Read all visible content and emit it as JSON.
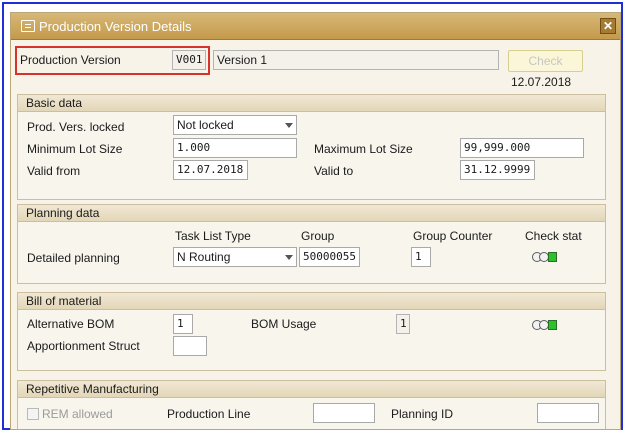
{
  "window": {
    "title": "Production Version Details",
    "close_glyph": "✕"
  },
  "header": {
    "production_version_label": "Production Version",
    "production_version_value": "V001",
    "description_value": "Version 1",
    "check_label": "Check",
    "date": "12.07.2018"
  },
  "basic_data": {
    "title": "Basic data",
    "locked_label": "Prod. Vers. locked",
    "locked_value": "Not locked",
    "min_lot_label": "Minimum Lot Size",
    "min_lot_value": "1.000",
    "max_lot_label": "Maximum Lot Size",
    "max_lot_value": "99,999.000",
    "valid_from_label": "Valid from",
    "valid_from_value": "12.07.2018",
    "valid_to_label": "Valid to",
    "valid_to_value": "31.12.9999"
  },
  "planning_data": {
    "title": "Planning data",
    "col_task_list_type": "Task List Type",
    "col_group": "Group",
    "col_group_counter": "Group Counter",
    "col_check_stat": "Check stat",
    "detailed_planning_label": "Detailed planning",
    "task_list_type_value": "N Routing",
    "group_value": "50000055",
    "group_counter_value": "1"
  },
  "bill_of_material": {
    "title": "Bill of material",
    "alt_bom_label": "Alternative BOM",
    "alt_bom_value": "1",
    "bom_usage_label": "BOM Usage",
    "bom_usage_value": "1",
    "apportionment_label": "Apportionment Struct",
    "apportionment_value": ""
  },
  "repetitive_manufacturing": {
    "title": "Repetitive Manufacturing",
    "rem_allowed_label": "REM allowed",
    "production_line_label": "Production Line",
    "production_line_value": "",
    "planning_id_label": "Planning ID",
    "planning_id_value": ""
  },
  "colors": {
    "title_bar": "#c9a257",
    "highlight": "#d8322d",
    "frame": "#1f2fd8",
    "status_green": "#2ac32a"
  },
  "icons": [
    "dialog-window-icon",
    "close-icon",
    "dropdown-arrow-icon",
    "traffic-light-status-icon",
    "checkbox-icon"
  ]
}
